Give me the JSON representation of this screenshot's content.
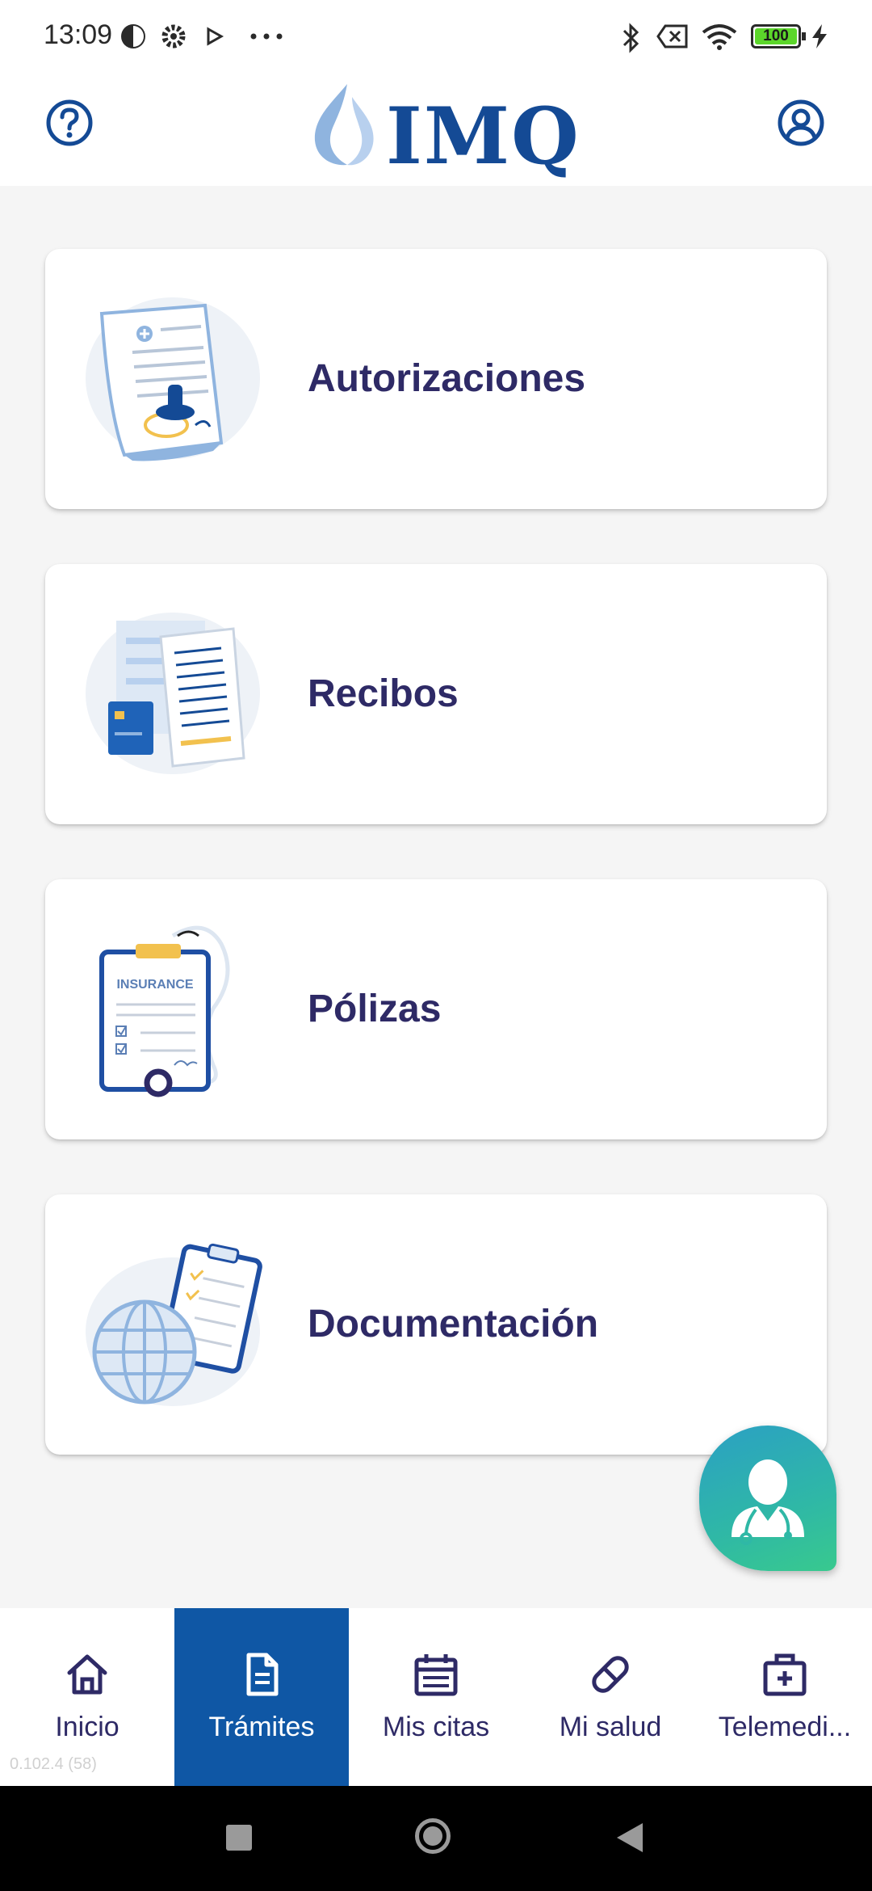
{
  "status_bar": {
    "time": "13:09",
    "battery": "100",
    "icons": [
      "data-saver-icon",
      "settings-icon",
      "play-store-icon",
      "more-dots-icon",
      "bluetooth-icon",
      "no-sim-icon",
      "wifi-icon",
      "battery-icon",
      "charging-icon"
    ]
  },
  "header": {
    "logo_text": "IMQ",
    "left_icon": "help-circle-icon",
    "right_icon": "user-circle-icon"
  },
  "cards": [
    {
      "label": "Autorizaciones",
      "icon": "authorization-document-stamp-icon"
    },
    {
      "label": "Recibos",
      "icon": "receipts-card-icon"
    },
    {
      "label": "Pólizas",
      "icon": "insurance-clipboard-icon",
      "illustration_text": "INSURANCE"
    },
    {
      "label": "Documentación",
      "icon": "globe-clipboard-icon"
    }
  ],
  "fab": {
    "icon": "doctor-icon"
  },
  "bottom_nav": {
    "items": [
      {
        "label": "Inicio",
        "icon": "home-icon"
      },
      {
        "label": "Trámites",
        "icon": "document-icon"
      },
      {
        "label": "Mis citas",
        "icon": "calendar-icon"
      },
      {
        "label": "Mi salud",
        "icon": "pill-icon"
      },
      {
        "label": "Telemedi...",
        "icon": "medical-kit-icon"
      }
    ],
    "active_index": 1
  },
  "version": "0.102.4 (58)",
  "colors": {
    "primary": "#0f57a5",
    "text_dark": "#2e2a66",
    "fab_gradient_start": "#2ba0c4",
    "fab_gradient_end": "#38c98e",
    "background": "#f5f5f5"
  }
}
